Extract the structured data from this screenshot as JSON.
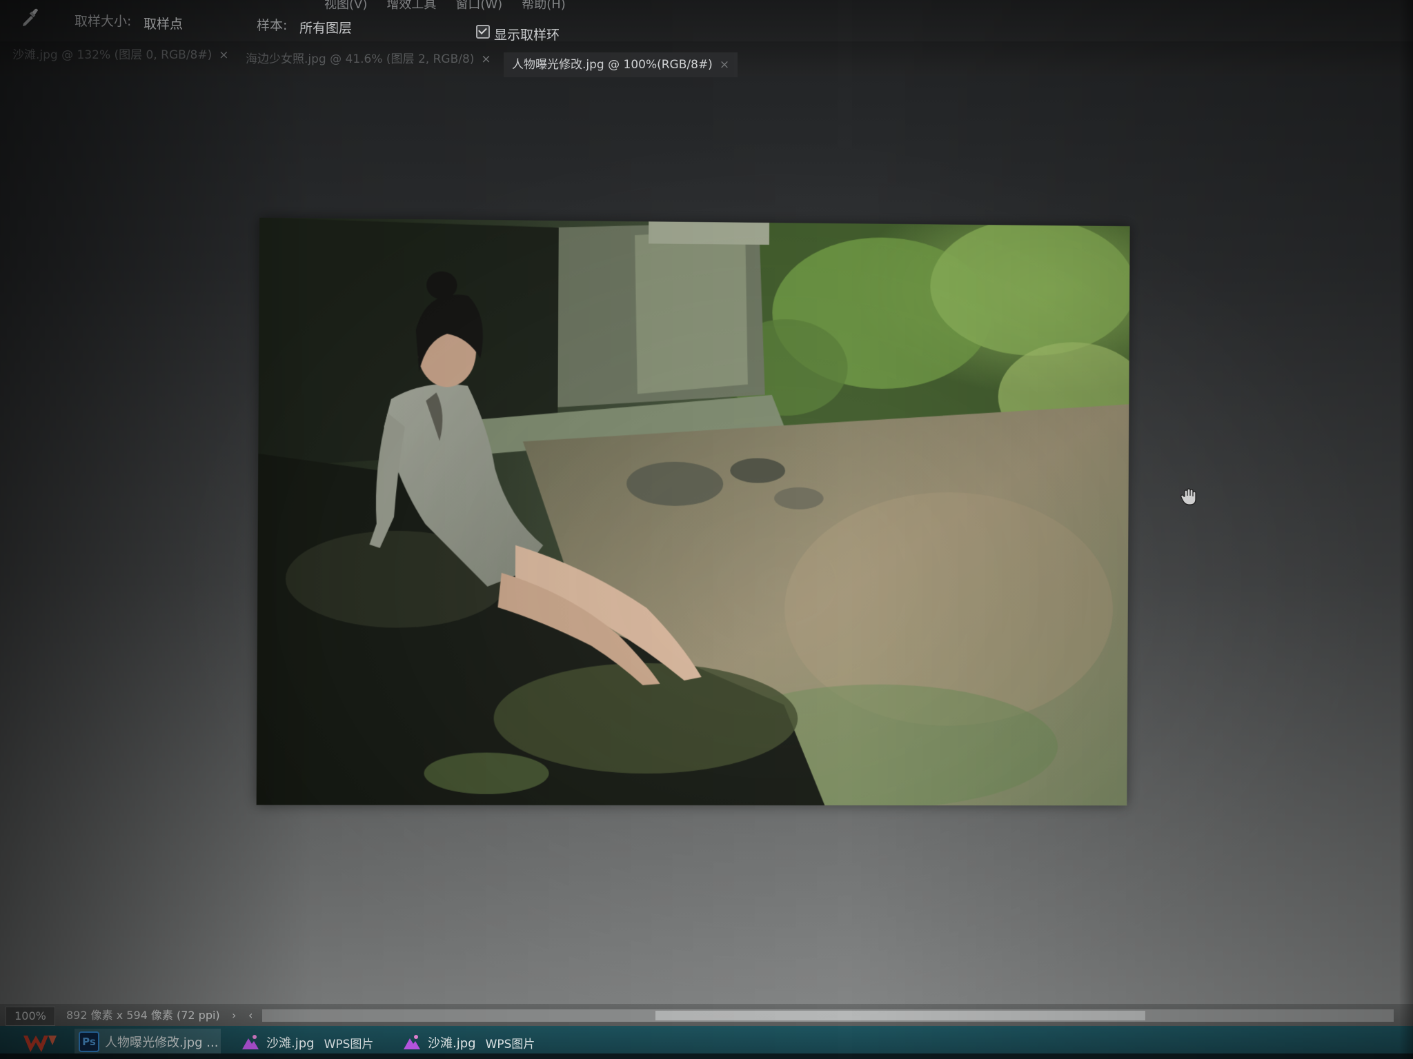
{
  "options_bar": {
    "tool_icon": "eyedropper-icon",
    "sample_size_label": "取样大小:",
    "sample_size_value": "取样点",
    "sample_label": "样本:",
    "sample_value": "所有图层",
    "show_ring_label": "显示取样环",
    "show_ring_checked": true
  },
  "menu": {
    "items": [
      "视图(V)",
      "增效工具",
      "窗口(W)",
      "帮助(H)"
    ]
  },
  "tabs": [
    {
      "label": "沙滩.jpg @ 132% (图层 0, RGB/8#)",
      "active": false
    },
    {
      "label": "海边少女照.jpg @ 41.6% (图层 2, RGB/8)",
      "active": false
    },
    {
      "label": "人物曝光修改.jpg @ 100%(RGB/8#)",
      "active": true
    }
  ],
  "canvas": {
    "image_description_icon": "photo-canvas",
    "cursor_icon": "hand-cursor-icon"
  },
  "status_bar": {
    "zoom": "100%",
    "doc_info": "892 像素 x 594 像素 (72 ppi)",
    "arrow_right": "›",
    "arrow_left": "‹"
  },
  "taskbar": {
    "start_icon": "wps-logo-icon",
    "items": [
      {
        "icon": "photoshop-icon",
        "label": "人物曝光修改.jpg ...",
        "sub": "",
        "active": true
      },
      {
        "icon": "wps-picture-icon",
        "label": "沙滩.jpg",
        "sub": "WPS图片",
        "active": false
      },
      {
        "icon": "wps-picture-icon",
        "label": "沙滩.jpg",
        "sub": "WPS图片",
        "active": false
      }
    ]
  }
}
